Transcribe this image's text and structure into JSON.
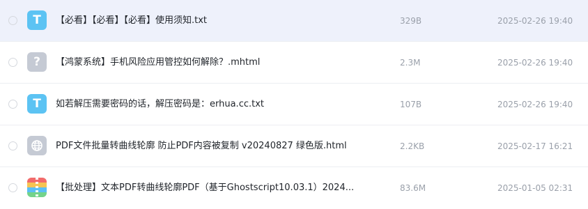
{
  "files": [
    {
      "name": "【必看】【必看】【必看】使用须知.txt",
      "size": "329B",
      "modified": "2025-02-26 19:40",
      "icon": "text-file-icon",
      "icon_glyph": "T",
      "selected": true
    },
    {
      "name": "【鸿蒙系统】手机风险应用管控如何解除？.mhtml",
      "size": "2.3M",
      "modified": "2025-02-26 19:40",
      "icon": "unknown-file-icon",
      "icon_glyph": "?",
      "selected": false
    },
    {
      "name": "如若解压需要密码的话，解压密码是：erhua.cc.txt",
      "size": "107B",
      "modified": "2025-02-26 19:40",
      "icon": "text-file-icon",
      "icon_glyph": "T",
      "selected": false
    },
    {
      "name": "PDF文件批量转曲线轮廓 防止PDF内容被复制 v20240827 绿色版.html",
      "size": "2.2KB",
      "modified": "2025-02-17 16:21",
      "icon": "html-file-icon",
      "icon_glyph": "",
      "selected": false
    },
    {
      "name": "【批处理】文本PDF转曲线轮廓PDF（基于Ghostscript10.03.1）2024...",
      "size": "83.6M",
      "modified": "2025-01-05 02:31",
      "icon": "zip-file-icon",
      "icon_glyph": "",
      "selected": false
    }
  ],
  "colors": {
    "selected_row_bg": "#eef1fb",
    "text_file_icon": "#5cc3f3",
    "unknown_file_icon": "#c5cad4",
    "meta_text": "#9aa0aa",
    "name_text": "#1f2329"
  }
}
